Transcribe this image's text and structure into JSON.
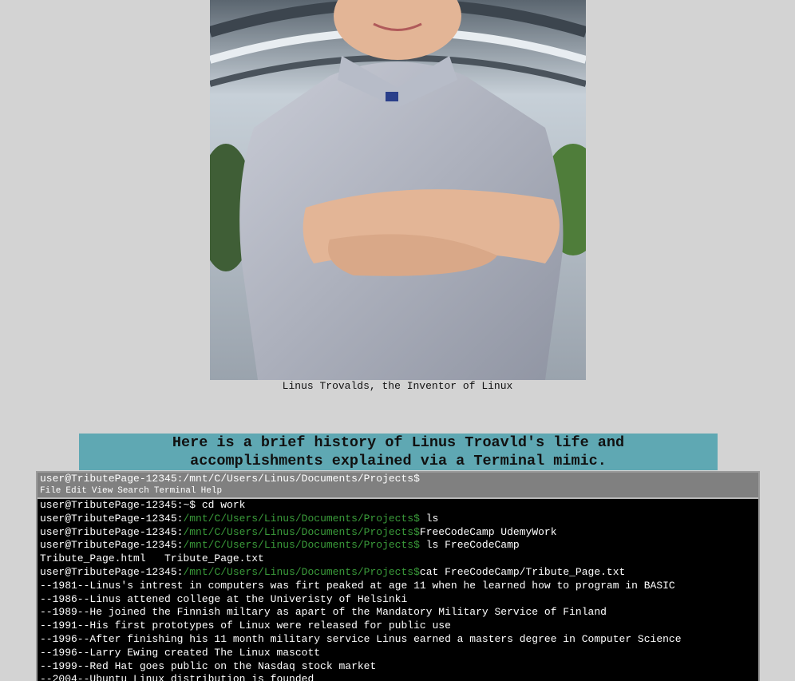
{
  "photo": {
    "alt": "Linus Trovalds, the Inventor of Linux"
  },
  "caption": "Linus Trovalds, the Inventor of Linux",
  "headline": {
    "line1": "Here is a brief history of Linus Troavld's life and",
    "line2": "accomplishments explained via a Terminal mimic."
  },
  "terminal": {
    "title": "user@TributePage-12345:/mnt/C/Users/Linus/Documents/Projects$",
    "menu": [
      "File",
      "Edit",
      "View",
      "Search",
      "Terminal",
      "Help"
    ],
    "lines": [
      {
        "prompt": "user@TributePage-12345:",
        "path": "",
        "text": "~$ cd work"
      },
      {
        "prompt": "user@TributePage-12345:",
        "path": "/mnt/C/Users/Linus/Documents/Projects$",
        "text": " ls"
      },
      {
        "prompt": "user@TributePage-12345:",
        "path": "/mnt/C/Users/Linus/Documents/Projects$",
        "text": "FreeCodeCamp UdemyWork"
      },
      {
        "prompt": "user@TributePage-12345:",
        "path": "/mnt/C/Users/Linus/Documents/Projects$",
        "text": " ls FreeCodeCamp"
      },
      {
        "prompt": "",
        "path": "",
        "text": "Tribute_Page.html   Tribute_Page.txt"
      },
      {
        "prompt": "user@TributePage-12345:",
        "path": "/mnt/C/Users/Linus/Documents/Projects$",
        "text": "cat FreeCodeCamp/Tribute_Page.txt"
      },
      {
        "prompt": "",
        "path": "",
        "text": "--1981--Linus's intrest in computers was firt peaked at age 11 when he learned how to program in BASIC"
      },
      {
        "prompt": "",
        "path": "",
        "text": "--1986--Linus attened college at the Univeristy of Helsinki"
      },
      {
        "prompt": "",
        "path": "",
        "text": "--1989--He joined the Finnish miltary as apart of the Mandatory Military Service of Finland"
      },
      {
        "prompt": "",
        "path": "",
        "text": "--1991--His first prototypes of Linux were released for public use"
      },
      {
        "prompt": "",
        "path": "",
        "text": "--1996--After finishing his 11 month military service Linus earned a masters degree in Computer Science"
      },
      {
        "prompt": "",
        "path": "",
        "text": "--1996--Larry Ewing created The Linux mascott"
      },
      {
        "prompt": "",
        "path": "",
        "text": "--1999--Red Hat goes public on the Nasdaq stock market"
      },
      {
        "prompt": "",
        "path": "",
        "text": "--2004--Ubuntu Linux distribution is founded"
      }
    ]
  },
  "colors": {
    "background": "#d3d3d3",
    "headline_bg": "#5fa8b3",
    "terminal_bg": "#000000",
    "terminal_bar": "#808080",
    "path_green": "#3a9b3a"
  }
}
